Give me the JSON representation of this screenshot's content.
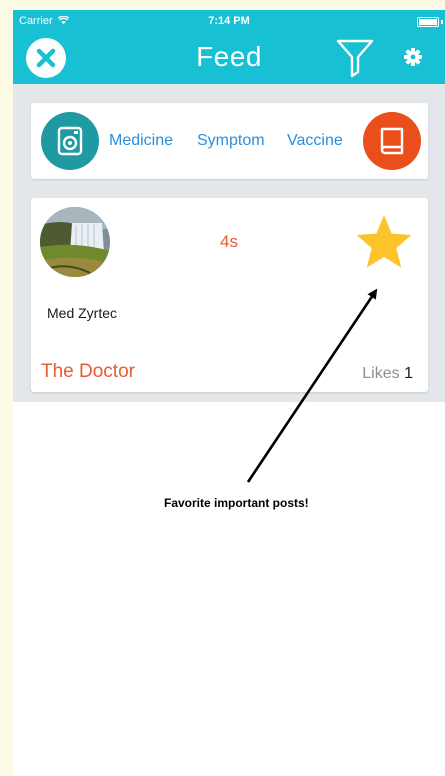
{
  "status_bar": {
    "carrier": "Carrier",
    "time": "7:14 PM"
  },
  "nav": {
    "title": "Feed",
    "close_icon": "close-icon",
    "filter_icon": "filter-icon",
    "settings_icon": "gear-icon"
  },
  "categories": {
    "camera_icon": "camera-icon",
    "book_icon": "book-icon",
    "items": [
      "Medicine",
      "Symptom",
      "Vaccine"
    ]
  },
  "post": {
    "time": "4s",
    "text": "Med Zyrtec",
    "author": "The Doctor",
    "likes_label": "Likes",
    "likes_count": "1",
    "favorite_icon": "star-icon"
  },
  "annotation": {
    "text": "Favorite important posts!"
  },
  "colors": {
    "accent": "#17c1d3",
    "link": "#2b8fd9",
    "highlight": "#ea5a33",
    "star": "#fcc32b"
  }
}
